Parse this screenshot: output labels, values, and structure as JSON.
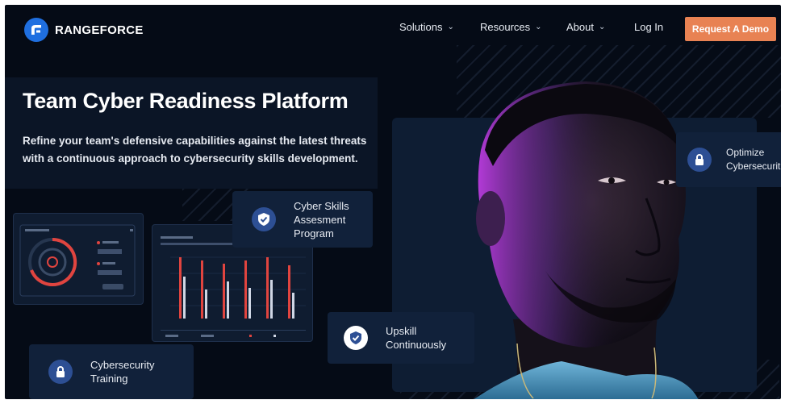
{
  "brand": {
    "name": "RANGEFORCE"
  },
  "nav": {
    "items": [
      {
        "label": "Solutions",
        "has_dropdown": true
      },
      {
        "label": "Resources",
        "has_dropdown": true
      },
      {
        "label": "About",
        "has_dropdown": true
      },
      {
        "label": "Log In",
        "has_dropdown": false
      }
    ],
    "cta_label": "Request A Demo"
  },
  "hero": {
    "title": "Team Cyber Readiness Platform",
    "subtitle": "Refine your team's defensive capabilities against the latest threats with a continuous approach to cybersecurity skills development."
  },
  "features": {
    "optimize": "Optimize Cybersecurit",
    "cyber_skills": "Cyber Skills Assesment Program",
    "upskill": "Upskill Continuously",
    "training": "Cybersecurity Training"
  },
  "icons": {
    "logo": "rangeforce-logo-icon",
    "dropdown": "chevron-down-icon",
    "shield": "shield-check-icon",
    "lock": "lock-icon"
  },
  "colors": {
    "background": "#050b16",
    "cta": "#e88253",
    "brand_blue": "#1f6fe0",
    "icon_circle": "#2d4f94",
    "chart_red": "#e0443f"
  }
}
